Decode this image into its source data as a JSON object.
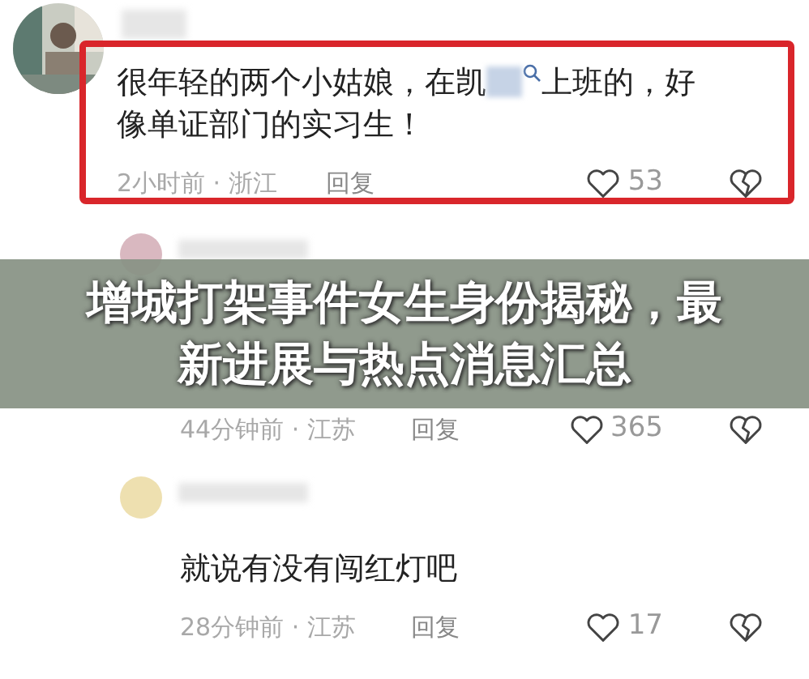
{
  "comments": [
    {
      "highlighted": true,
      "text_before": "很年轻的两个小姑娘，在凯",
      "text_after": "上班的，好像单证部门的实习生！",
      "time": "2小时前",
      "sep": "·",
      "region": "浙江",
      "reply": "回复",
      "likes": "53"
    },
    {
      "avatar": {
        "kind": "color",
        "color": "#d9b8c0"
      },
      "highlighted": false,
      "time": "44分钟前",
      "sep": "·",
      "region": "江苏",
      "reply": "回复",
      "likes": "365"
    },
    {
      "avatar": {
        "kind": "color",
        "color": "#eee0b0"
      },
      "highlighted": false,
      "text_before": "就说有没有闯红灯吧",
      "time": "28分钟前",
      "sep": "·",
      "region": "江苏",
      "reply": "回复",
      "likes": "17"
    }
  ],
  "banner": {
    "title": "增城打架事件女生身份揭秘，最新进展与热点消息汇总"
  }
}
